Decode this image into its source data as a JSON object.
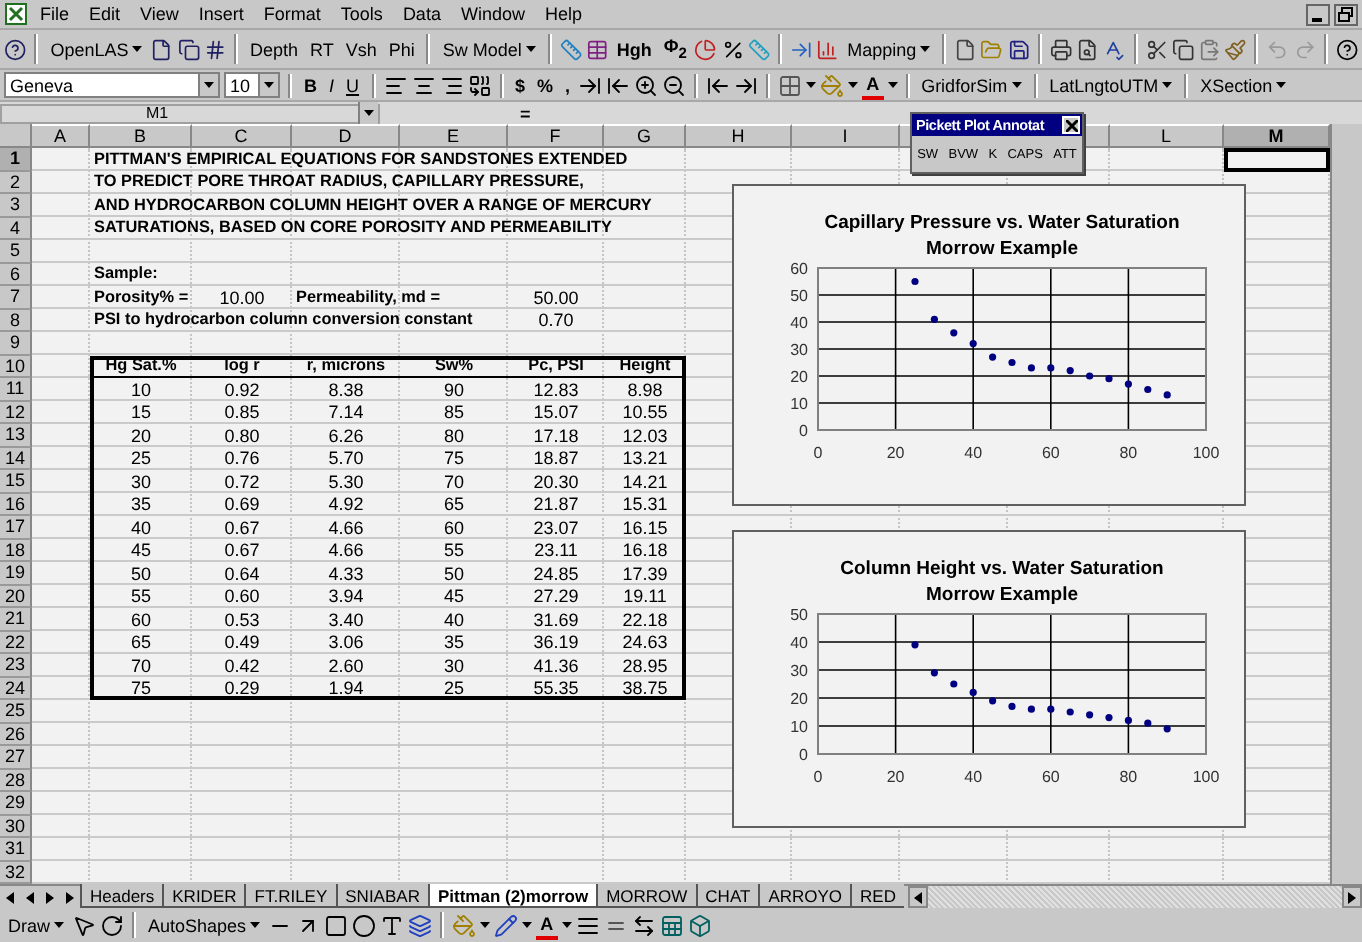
{
  "menu": [
    "File",
    "Edit",
    "View",
    "Insert",
    "Format",
    "Tools",
    "Data",
    "Window",
    "Help"
  ],
  "toolbar_standard": {
    "openlas": "OpenLAS",
    "log_buttons": [
      "Depth",
      "RT",
      "Vsh",
      "Phi"
    ],
    "sw_model": "Sw Model",
    "hgh": "Hgh",
    "phi2": "Φ$_{2}$",
    "mapping": "Mapping"
  },
  "toolbar_format": {
    "font": "Geneva",
    "size": "10",
    "styles": [
      "B",
      "I",
      "U"
    ],
    "currency": "$",
    "percent": "%",
    "comma": ",",
    "font_color": "A",
    "menus": [
      "GridforSim",
      "LatLngtoUTM",
      "XSection"
    ]
  },
  "formula_bar": {
    "name_box": "M1",
    "equals": "="
  },
  "floating_toolbar": {
    "title": "Pickett Plot Annotat",
    "buttons": [
      "SW",
      "BVW",
      "K",
      "CAPS",
      "ATT"
    ]
  },
  "columns": [
    {
      "label": "A",
      "selected": false
    },
    {
      "label": "B",
      "selected": false
    },
    {
      "label": "C",
      "selected": false
    },
    {
      "label": "D",
      "selected": false
    },
    {
      "label": "E",
      "selected": false
    },
    {
      "label": "F",
      "selected": false
    },
    {
      "label": "G",
      "selected": false
    },
    {
      "label": "H",
      "selected": false
    },
    {
      "label": "I",
      "selected": false
    },
    {
      "selected": false
    },
    {
      "selected": false
    },
    {
      "label": "L",
      "selected": false
    },
    {
      "label": "M",
      "selected": true
    }
  ],
  "rows": [
    {
      "label": "1",
      "selected": true
    },
    {
      "label": "2",
      "selected": false
    },
    {
      "label": "3",
      "selected": false
    },
    {
      "label": "4",
      "selected": false
    },
    {
      "label": "5",
      "selected": false
    },
    {
      "label": "6",
      "selected": false
    },
    {
      "label": "7",
      "selected": false
    },
    {
      "label": "8",
      "selected": false
    },
    {
      "label": "9",
      "selected": false
    },
    {
      "label": "10",
      "selected": false
    },
    {
      "label": "11",
      "selected": false
    },
    {
      "label": "12",
      "selected": false
    },
    {
      "label": "13",
      "selected": false
    },
    {
      "label": "14",
      "selected": false
    },
    {
      "label": "15",
      "selected": false
    },
    {
      "label": "16",
      "selected": false
    },
    {
      "label": "17",
      "selected": false
    },
    {
      "label": "18",
      "selected": false
    },
    {
      "label": "19",
      "selected": false
    },
    {
      "label": "20",
      "selected": false
    },
    {
      "label": "21",
      "selected": false
    },
    {
      "label": "22",
      "selected": false
    },
    {
      "label": "23",
      "selected": false
    },
    {
      "label": "24",
      "selected": false
    },
    {
      "label": "25",
      "selected": false
    },
    {
      "label": "26",
      "selected": false
    },
    {
      "label": "27",
      "selected": false
    },
    {
      "label": "28",
      "selected": false
    },
    {
      "label": "29",
      "selected": false
    },
    {
      "label": "30",
      "selected": false
    },
    {
      "label": "31",
      "selected": false
    },
    {
      "label": "32",
      "selected": false
    }
  ],
  "title_lines": [
    "PITTMAN'S EMPIRICAL EQUATIONS FOR SANDSTONES EXTENDED",
    "TO PREDICT PORE THROAT RADIUS, CAPILLARY PRESSURE,",
    "AND HYDROCARBON COLUMN HEIGHT OVER A RANGE OF MERCURY",
    "SATURATIONS, BASED ON CORE POROSITY AND PERMEABILITY"
  ],
  "sample": {
    "label": "Sample:",
    "porosity_label": "Porosity% =",
    "porosity": "10.00",
    "permeability_label": "Permeability, md =",
    "permeability": "50.00",
    "constant_label": "PSI to hydrocarbon column conversion constant",
    "constant": "0.70"
  },
  "table": {
    "columns": [
      "Hg Sat.%",
      "log r",
      "r, microns",
      "Sw%",
      "Pc, PSI",
      "Height"
    ],
    "rows": [
      [
        "10",
        "0.92",
        "8.38",
        "90",
        "12.83",
        "8.98"
      ],
      [
        "15",
        "0.85",
        "7.14",
        "85",
        "15.07",
        "10.55"
      ],
      [
        "20",
        "0.80",
        "6.26",
        "80",
        "17.18",
        "12.03"
      ],
      [
        "25",
        "0.76",
        "5.70",
        "75",
        "18.87",
        "13.21"
      ],
      [
        "30",
        "0.72",
        "5.30",
        "70",
        "20.30",
        "14.21"
      ],
      [
        "35",
        "0.69",
        "4.92",
        "65",
        "21.87",
        "15.31"
      ],
      [
        "40",
        "0.67",
        "4.66",
        "60",
        "23.07",
        "16.15"
      ],
      [
        "45",
        "0.67",
        "4.66",
        "55",
        "23.11",
        "16.18"
      ],
      [
        "50",
        "0.64",
        "4.33",
        "50",
        "24.85",
        "17.39"
      ],
      [
        "55",
        "0.60",
        "3.94",
        "45",
        "27.29",
        "19.11"
      ],
      [
        "60",
        "0.53",
        "3.40",
        "40",
        "31.69",
        "22.18"
      ],
      [
        "65",
        "0.49",
        "3.06",
        "35",
        "36.19",
        "24.63"
      ],
      [
        "70",
        "0.42",
        "2.60",
        "30",
        "41.36",
        "28.95"
      ],
      [
        "75",
        "0.29",
        "1.94",
        "25",
        "55.35",
        "38.75"
      ]
    ]
  },
  "charts": [
    {
      "title": "Capillary Pressure vs. Water Saturation",
      "subtitle": "Morrow Example",
      "chart_data": {
        "type": "scatter",
        "x": [
          90,
          85,
          80,
          75,
          70,
          65,
          60,
          55,
          50,
          45,
          40,
          35,
          30,
          25
        ],
        "series": [
          {
            "color": "#000080",
            "values": [
              13,
              15,
              17,
              19,
              20,
              22,
              23,
              23,
              25,
              27,
              32,
              36,
              41,
              55
            ]
          }
        ],
        "grid": true,
        "xlim": [
          0,
          100
        ],
        "ylim": [
          0,
          60
        ],
        "xticks": [
          0,
          20,
          40,
          60,
          80,
          100
        ],
        "yticks": [
          0,
          10,
          20,
          30,
          40,
          50,
          60
        ]
      }
    },
    {
      "title": "Column Height vs. Water Saturation",
      "subtitle": "Morrow Example",
      "chart_data": {
        "type": "scatter",
        "x": [
          90,
          85,
          80,
          75,
          70,
          65,
          60,
          55,
          50,
          45,
          40,
          35,
          30,
          25
        ],
        "series": [
          {
            "color": "#000080",
            "values": [
              9,
              11,
              12,
              13,
              14,
              15,
              16,
              16,
              17,
              19,
              22,
              25,
              29,
              39
            ]
          }
        ],
        "grid": true,
        "xlim": [
          0,
          100
        ],
        "ylim": [
          0,
          50
        ],
        "xticks": [
          0,
          20,
          40,
          60,
          80,
          100
        ],
        "yticks": [
          0,
          10,
          20,
          30,
          40,
          50
        ]
      }
    }
  ],
  "sheet_tabs": [
    {
      "label": "Headers",
      "selected": false
    },
    {
      "label": "KRIDER",
      "selected": false
    },
    {
      "label": "FT.RILEY",
      "selected": false
    },
    {
      "label": "SNIABAR",
      "selected": false
    },
    {
      "label": "Pittman (2)morrow",
      "selected": true
    },
    {
      "label": "MORROW",
      "selected": false
    },
    {
      "label": "CHAT",
      "selected": false
    },
    {
      "label": "ARROYO",
      "selected": false
    },
    {
      "label": "RED",
      "selected": false
    }
  ],
  "draw_toolbar": {
    "draw": "Draw",
    "autoshapes": "AutoShapes",
    "font_color": "A"
  }
}
